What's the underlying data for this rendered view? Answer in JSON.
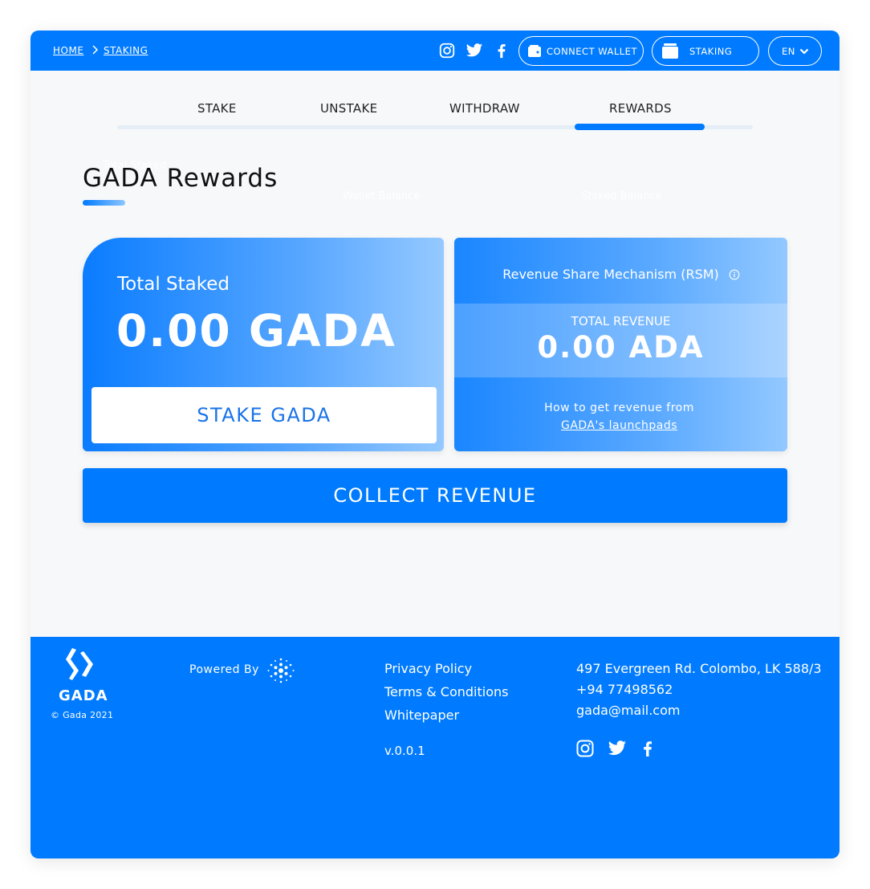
{
  "breadcrumb": {
    "home": "HOME",
    "current": "STAKING"
  },
  "header": {
    "connect_wallet": "CONNECT WALLET",
    "staking": "STAKING",
    "language": "EN"
  },
  "tabs": [
    {
      "label": "STAKE",
      "active": false
    },
    {
      "label": "UNSTAKE",
      "active": false
    },
    {
      "label": "WITHDRAW",
      "active": false
    },
    {
      "label": "REWARDS",
      "active": true
    }
  ],
  "page": {
    "title": "GADA Rewards",
    "ghost_labels": [
      "Total Staked",
      "Wallet Balance",
      "Staked Balance"
    ]
  },
  "total_staked": {
    "label": "Total Staked",
    "value": "0.00 GADA",
    "button": "STAKE GADA"
  },
  "rsm": {
    "title": "Revenue Share Mechanism (RSM)",
    "total_revenue_label": "TOTAL REVENUE",
    "total_revenue_value": "0.00 ADA",
    "how_text": "How to get revenue from",
    "how_link": "GADA's launchpads"
  },
  "collect_button": "COLLECT REVENUE",
  "footer": {
    "brand": "GADA",
    "copyright": "© Gada 2021",
    "powered_by": "Powered By",
    "links": [
      "Privacy Policy",
      "Terms & Conditions",
      "Whitepaper"
    ],
    "version": "v.0.0.1",
    "address": "497 Evergreen Rd. Colombo, LK 588/3",
    "phone": "+94 77498562",
    "email": "gada@mail.com"
  },
  "colors": {
    "primary": "#007bff",
    "background": "#f7f8fa",
    "tab_track": "#e5edf6",
    "stake_button_text": "#1a73e8"
  },
  "icons": [
    "instagram-icon",
    "twitter-icon",
    "facebook-icon",
    "wallet-icon",
    "staking-icon",
    "chevron-down-icon",
    "chevron-right-icon",
    "info-icon",
    "gada-logo-icon",
    "cardano-logo-icon"
  ]
}
